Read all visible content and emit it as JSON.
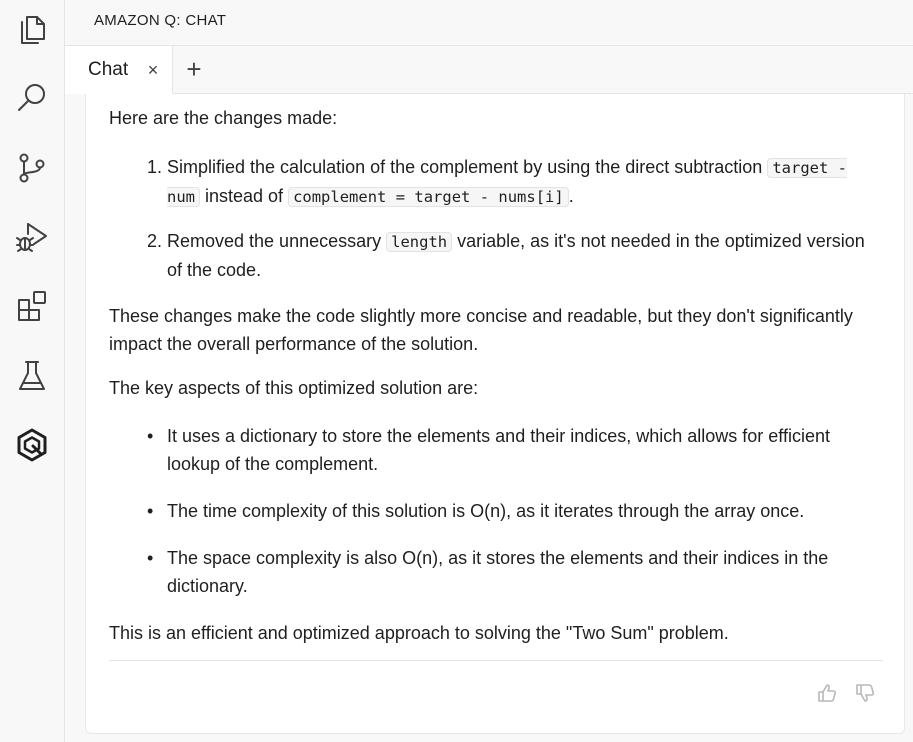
{
  "panel": {
    "title": "AMAZON Q: CHAT"
  },
  "activity_bar": {
    "items": [
      {
        "name": "explorer-icon"
      },
      {
        "name": "search-icon"
      },
      {
        "name": "source-control-icon"
      },
      {
        "name": "run-debug-icon"
      },
      {
        "name": "extensions-icon"
      },
      {
        "name": "testing-icon"
      },
      {
        "name": "amazon-q-icon"
      }
    ]
  },
  "tabs": [
    {
      "label": "Chat",
      "close": "×"
    }
  ],
  "tab_add": "+",
  "message": {
    "intro": "Here are the changes made:",
    "list1": [
      {
        "num": "1.",
        "pre": "Simplified the calculation of the complement by using the direct subtraction ",
        "code1": "target - num",
        "mid": " instead of ",
        "code2": "complement = target - nums[i]",
        "post": "."
      },
      {
        "num": "2.",
        "pre": "Removed the unnecessary ",
        "code1": "length",
        "post": " variable, as it's not needed in the optimized version of the code."
      }
    ],
    "para2": "These changes make the code slightly more concise and readable, but they don't significantly impact the overall performance of the solution.",
    "para3": "The key aspects of this optimized solution are:",
    "bullets": [
      "It uses a dictionary to store the elements and their indices, which allows for efficient lookup of the complement.",
      "The time complexity of this solution is O(n), as it iterates through the array once.",
      "The space complexity is also O(n), as it stores the elements and their indices in the dictionary."
    ],
    "bullet_char": "•",
    "para4": "This is an efficient and optimized approach to solving the \"Two Sum\" problem."
  },
  "feedback": {
    "up_icon": "thumbs-up-icon",
    "down_icon": "thumbs-down-icon"
  }
}
